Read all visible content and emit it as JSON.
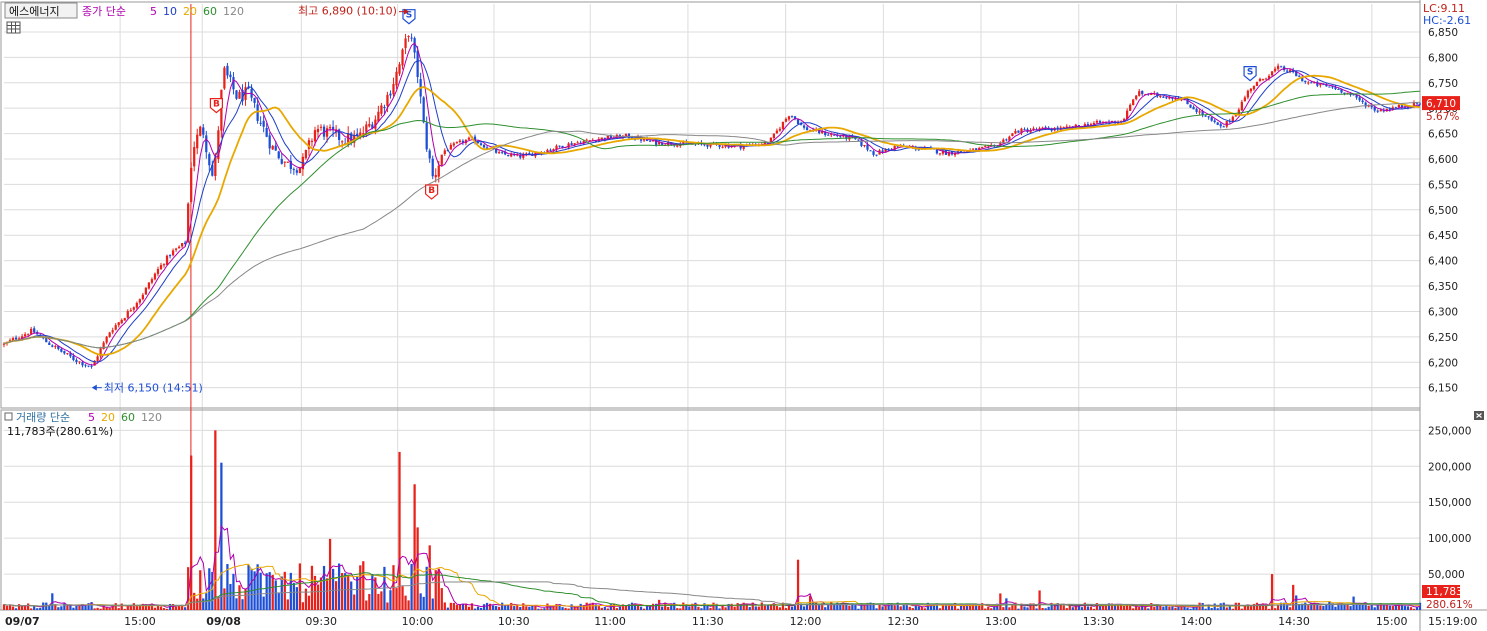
{
  "chart_data": [
    {
      "type": "candlestick",
      "name": "price",
      "legend": {
        "symbol": "에스에너지",
        "indicator": "종가 단순",
        "periods": [
          "5",
          "10",
          "20",
          "60",
          "120"
        ],
        "period_colors": [
          "#b000b0",
          "#1e3ec8",
          "#e8a800",
          "#2f8f2f",
          "#888888"
        ]
      },
      "ylim": [
        6110,
        6905
      ],
      "yticks": [
        "6,850",
        "6,800",
        "6,750",
        "6,700",
        "6,650",
        "6,600",
        "6,550",
        "6,500",
        "6,450",
        "6,400",
        "6,350",
        "6,300",
        "6,250",
        "6,200",
        "6,150"
      ],
      "ytick_values": [
        6850,
        6800,
        6750,
        6700,
        6650,
        6600,
        6550,
        6500,
        6450,
        6400,
        6350,
        6300,
        6250,
        6200,
        6150
      ],
      "current_price_label": "6,710",
      "current_price": 6710,
      "current_change_label": "5.67%",
      "lc_label": "LC:9.11",
      "hc_label": "HC:-2.61",
      "high_annotation": "최고 6,890 (10:10)",
      "low_annotation": "최저 6,150 (14:51)",
      "markers": [
        {
          "letter": "B",
          "t": 0.15,
          "price": 6705
        },
        {
          "letter": "S",
          "t": 0.286,
          "price": 6880
        },
        {
          "letter": "B",
          "t": 0.302,
          "price": 6535
        },
        {
          "letter": "S",
          "t": 0.88,
          "price": 6768
        }
      ],
      "anchors": [
        [
          0.0,
          6235
        ],
        [
          0.01,
          6250
        ],
        [
          0.02,
          6262
        ],
        [
          0.03,
          6240
        ],
        [
          0.04,
          6222
        ],
        [
          0.05,
          6205
        ],
        [
          0.062,
          6190
        ],
        [
          0.065,
          6208
        ],
        [
          0.075,
          6262
        ],
        [
          0.085,
          6290
        ],
        [
          0.097,
          6330
        ],
        [
          0.108,
          6380
        ],
        [
          0.118,
          6415
        ],
        [
          0.128,
          6435
        ],
        [
          0.133,
          6620
        ],
        [
          0.14,
          6665
        ],
        [
          0.148,
          6555
        ],
        [
          0.155,
          6775
        ],
        [
          0.165,
          6720
        ],
        [
          0.172,
          6730
        ],
        [
          0.18,
          6680
        ],
        [
          0.19,
          6620
        ],
        [
          0.2,
          6590
        ],
        [
          0.21,
          6585
        ],
        [
          0.22,
          6660
        ],
        [
          0.23,
          6650
        ],
        [
          0.24,
          6640
        ],
        [
          0.25,
          6640
        ],
        [
          0.262,
          6680
        ],
        [
          0.272,
          6730
        ],
        [
          0.28,
          6790
        ],
        [
          0.286,
          6855
        ],
        [
          0.292,
          6770
        ],
        [
          0.297,
          6650
        ],
        [
          0.303,
          6560
        ],
        [
          0.31,
          6615
        ],
        [
          0.32,
          6630
        ],
        [
          0.33,
          6640
        ],
        [
          0.34,
          6625
        ],
        [
          0.35,
          6610
        ],
        [
          0.365,
          6605
        ],
        [
          0.38,
          6615
        ],
        [
          0.4,
          6630
        ],
        [
          0.42,
          6640
        ],
        [
          0.44,
          6645
        ],
        [
          0.46,
          6632
        ],
        [
          0.48,
          6630
        ],
        [
          0.5,
          6628
        ],
        [
          0.52,
          6625
        ],
        [
          0.54,
          6632
        ],
        [
          0.555,
          6690
        ],
        [
          0.565,
          6660
        ],
        [
          0.58,
          6650
        ],
        [
          0.6,
          6640
        ],
        [
          0.615,
          6610
        ],
        [
          0.63,
          6625
        ],
        [
          0.65,
          6620
        ],
        [
          0.665,
          6612
        ],
        [
          0.68,
          6615
        ],
        [
          0.7,
          6625
        ],
        [
          0.715,
          6655
        ],
        [
          0.73,
          6658
        ],
        [
          0.75,
          6660
        ],
        [
          0.77,
          6670
        ],
        [
          0.79,
          6675
        ],
        [
          0.8,
          6730
        ],
        [
          0.815,
          6725
        ],
        [
          0.83,
          6720
        ],
        [
          0.845,
          6690
        ],
        [
          0.86,
          6660
        ],
        [
          0.87,
          6690
        ],
        [
          0.88,
          6740
        ],
        [
          0.89,
          6760
        ],
        [
          0.9,
          6780
        ],
        [
          0.91,
          6770
        ],
        [
          0.92,
          6750
        ],
        [
          0.93,
          6745
        ],
        [
          0.94,
          6740
        ],
        [
          0.95,
          6728
        ],
        [
          0.96,
          6710
        ],
        [
          0.97,
          6695
        ],
        [
          0.98,
          6700
        ],
        [
          0.99,
          6705
        ],
        [
          1.0,
          6710
        ]
      ]
    },
    {
      "type": "bar",
      "name": "volume",
      "legend": {
        "indicator": "거래량 단순",
        "periods": [
          "5",
          "20",
          "60",
          "120"
        ],
        "period_colors": [
          "#b000b0",
          "#e8a800",
          "#2f8f2f",
          "#888888"
        ]
      },
      "subtitle": "11,783주(280.61%)",
      "ylim": [
        0,
        270000
      ],
      "yticks": [
        "250,000",
        "200,000",
        "150,000",
        "100,000",
        "50,000"
      ],
      "ytick_values": [
        250000,
        200000,
        150000,
        100000,
        50000
      ],
      "current_volume_label": "11,783",
      "current_ratio_label": "280.61%",
      "spikes": [
        {
          "t": 0.133,
          "value": 215000,
          "color": "red"
        },
        {
          "t": 0.15,
          "value": 250000,
          "color": "red"
        },
        {
          "t": 0.153,
          "value": 205000,
          "color": "blue"
        },
        {
          "t": 0.23,
          "value": 99000,
          "color": "red"
        },
        {
          "t": 0.28,
          "value": 220000,
          "color": "red"
        },
        {
          "t": 0.289,
          "value": 175000,
          "color": "red"
        },
        {
          "t": 0.292,
          "value": 115000,
          "color": "red"
        },
        {
          "t": 0.3,
          "value": 90000,
          "color": "red"
        },
        {
          "t": 0.56,
          "value": 70000,
          "color": "red"
        },
        {
          "t": 0.895,
          "value": 50000,
          "color": "red"
        },
        {
          "t": 0.91,
          "value": 35000,
          "color": "red"
        }
      ]
    }
  ],
  "time_axis": {
    "labels": [
      {
        "text": "09/07",
        "t": 0.0
      },
      {
        "text": "15:00",
        "t": 0.082
      },
      {
        "text": "09/08",
        "t": 0.14
      },
      {
        "text": "09:30",
        "t": 0.21
      },
      {
        "text": "10:00",
        "t": 0.278
      },
      {
        "text": "10:30",
        "t": 0.346
      },
      {
        "text": "11:00",
        "t": 0.414
      },
      {
        "text": "11:30",
        "t": 0.483
      },
      {
        "text": "12:00",
        "t": 0.552
      },
      {
        "text": "12:30",
        "t": 0.621
      },
      {
        "text": "13:00",
        "t": 0.69
      },
      {
        "text": "13:30",
        "t": 0.759
      },
      {
        "text": "14:00",
        "t": 0.828
      },
      {
        "text": "14:30",
        "t": 0.897
      },
      {
        "text": "15:00",
        "t": 0.966
      }
    ],
    "right_time": "15:19:00",
    "day_divider_t": 0.132
  },
  "colors": {
    "up": "#e8211a",
    "down": "#1d4fd6",
    "grid": "#dcdcdc",
    "day_divider": "#e8211a",
    "axis_text": "#222222",
    "price_box_bg": "#e8211a"
  },
  "icons": {
    "table": "table-icon",
    "close": "close-icon"
  }
}
